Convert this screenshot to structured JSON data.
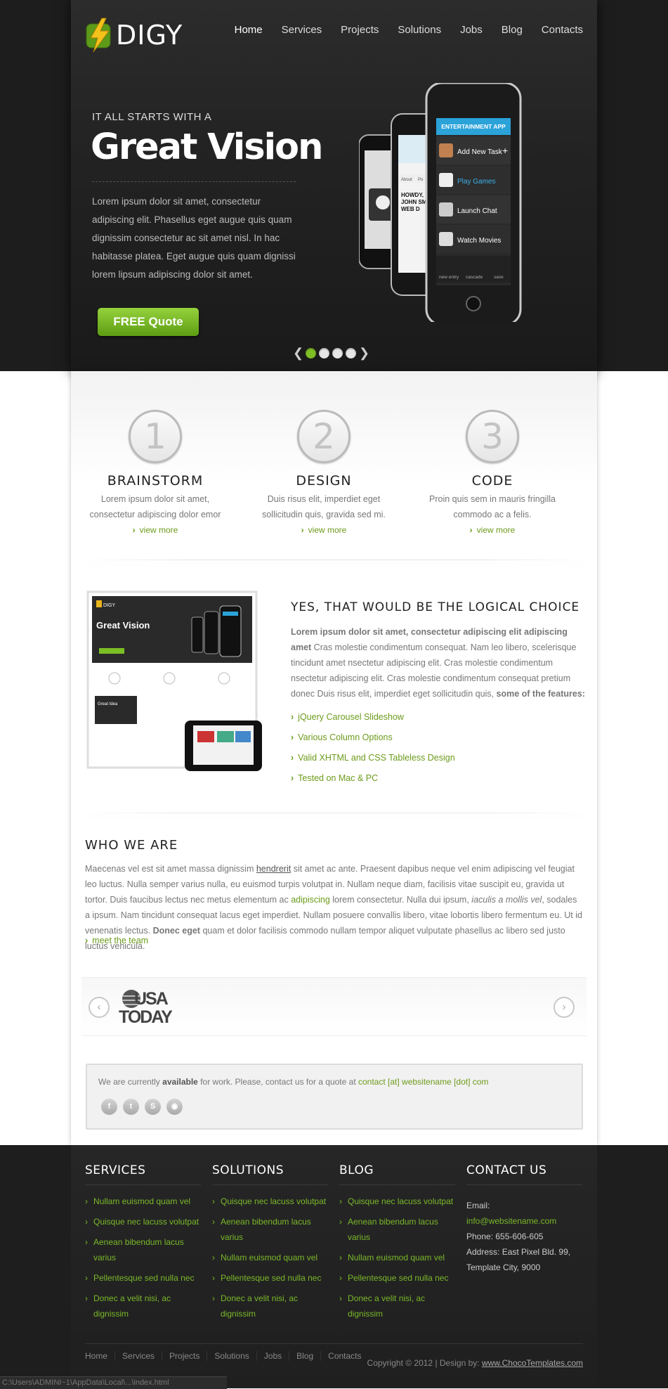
{
  "header": {
    "logo_text": "DIGY",
    "nav": [
      "Home",
      "Services",
      "Projects",
      "Solutions",
      "Jobs",
      "Blog",
      "Contacts"
    ],
    "active_nav": "Home"
  },
  "hero": {
    "pretitle": "IT ALL STARTS WITH A",
    "title": "Great Vision",
    "text": "Lorem ipsum dolor sit amet, consectetur adipiscing elit. Phasellus eget augue quis quam dignissim consectetur ac sit amet nisl. In hac habitasse platea. Eget augue quis quam dignissi lorem lipsum adipiscing dolor sit amet.",
    "cta": "FREE Quote",
    "slides": 4,
    "active_slide": 1,
    "phone": {
      "app_title": "ENTERTAINMENT APP",
      "menu": [
        "Add New Task",
        "Play Games",
        "Launch Chat",
        "Watch Movies"
      ],
      "tabs": [
        "new entry",
        "cascade",
        "save"
      ],
      "back_phone_text": "HOWDY, I'M JOHN SMITH, I'M WEB D",
      "back_phone_tabs": [
        "About",
        "Po"
      ]
    }
  },
  "features": [
    {
      "number": "1",
      "title": "BRAINSTORM",
      "text": "Lorem ipsum dolor sit amet, consectetur adipiscing dolor emor",
      "link": "view more"
    },
    {
      "number": "2",
      "title": "DESIGN",
      "text": "Duis risus elit, imperdiet eget sollicitudin quis, gravida sed mi.",
      "link": "view more"
    },
    {
      "number": "3",
      "title": "CODE",
      "text": "Proin quis sem in mauris fringilla commodo ac a felis.",
      "link": "view more"
    }
  ],
  "choice": {
    "title": "YES, THAT WOULD BE THE LOGICAL CHOICE",
    "lead": "Lorem ipsum dolor sit amet, consectetur adipiscing elit adipiscing amet",
    "body": "Cras molestie condimentum consequat. Nam leo libero, scelerisque tincidunt amet nsectetur adipiscing elit. Cras molestie condimentum nsectetur adipiscing elit. Cras molestie condimentum consequat pretium donec Duis risus elit, imperdiet eget sollicitudin quis,",
    "tail": "some of the features:",
    "features": [
      "jQuery Carousel Slideshow",
      "Various Column Options",
      "Valid XHTML and CSS Tableless Design",
      "Tested on Mac & PC"
    ]
  },
  "who": {
    "title": "WHO WE ARE",
    "p1": "Maecenas vel est sit amet massa dignissim",
    "u1": "hendrerit",
    "p2": "sit amet ac ante. Praesent dapibus neque vel enim adipiscing vel feugiat leo luctus. Nulla semper varius nulla, eu euismod turpis volutpat in. Nullam neque diam, facilisis vitae suscipit eu, gravida ut tortor. Duis faucibus lectus nec metus elementum ac",
    "link1": "adipiscing",
    "p3": "lorem consectetur. Nulla dui ipsum,",
    "i1": "iaculis a mollis vel",
    "p4": ", sodales a ipsum. Nam tincidunt consequat lacus eget imperdiet. Nullam posuere convallis libero, vitae lobortis libero fermentum eu. Ut id venenatis lectus.",
    "b1": "Donec eget",
    "p5": "quam et dolor facilisis commodo nullam tempor aliquet vulputate phasellus ac libero sed justo luctus vehicula.",
    "meet": "meet the team"
  },
  "clients": {
    "logo": [
      "USA",
      "TODAY"
    ]
  },
  "availability": {
    "pre": "We are currently",
    "bold": "available",
    "mid": "for work. Please, contact us for a quote at",
    "email": "contact [at] websitename [dot] com",
    "social": [
      "facebook-icon",
      "twitter-icon",
      "skype-icon",
      "rss-icon"
    ]
  },
  "footer": {
    "services_title": "SERVICES",
    "services": [
      "Nullam euismod quam vel",
      "Quisque nec lacuss volutpat",
      "Aenean bibendum lacus varius",
      "Pellentesque sed nulla nec",
      "Donec a velit nisi, ac dignissim"
    ],
    "solutions_title": "SOLUTIONS",
    "solutions": [
      "Quisque nec lacuss volutpat",
      "Aenean bibendum lacus varius",
      "Nullam euismod quam vel",
      "Pellentesque sed nulla nec",
      "Donec a velit nisi, ac dignissim"
    ],
    "blog_title": "BLOG",
    "blog": [
      "Quisque nec lacuss volutpat",
      "Aenean bibendum lacus varius",
      "Nullam euismod quam vel",
      "Pellentesque sed nulla nec",
      "Donec a velit nisi, ac dignissim"
    ],
    "contact_title": "CONTACT US",
    "email_label": "Email:",
    "email": "info@websitename.com",
    "phone": "Phone: 655-606-605",
    "address": "Address: East Pixel Bld. 99, Template City, 9000",
    "bottom_nav": [
      "Home",
      "Services",
      "Projects",
      "Solutions",
      "Jobs",
      "Blog",
      "Contacts"
    ],
    "copyright": "Copyright © 2012  |  Design by:",
    "designer": "www.ChocoTemplates.com"
  },
  "statusbar": "C:\\Users\\ADMINI~1\\AppData\\Local\\...\\index.html"
}
